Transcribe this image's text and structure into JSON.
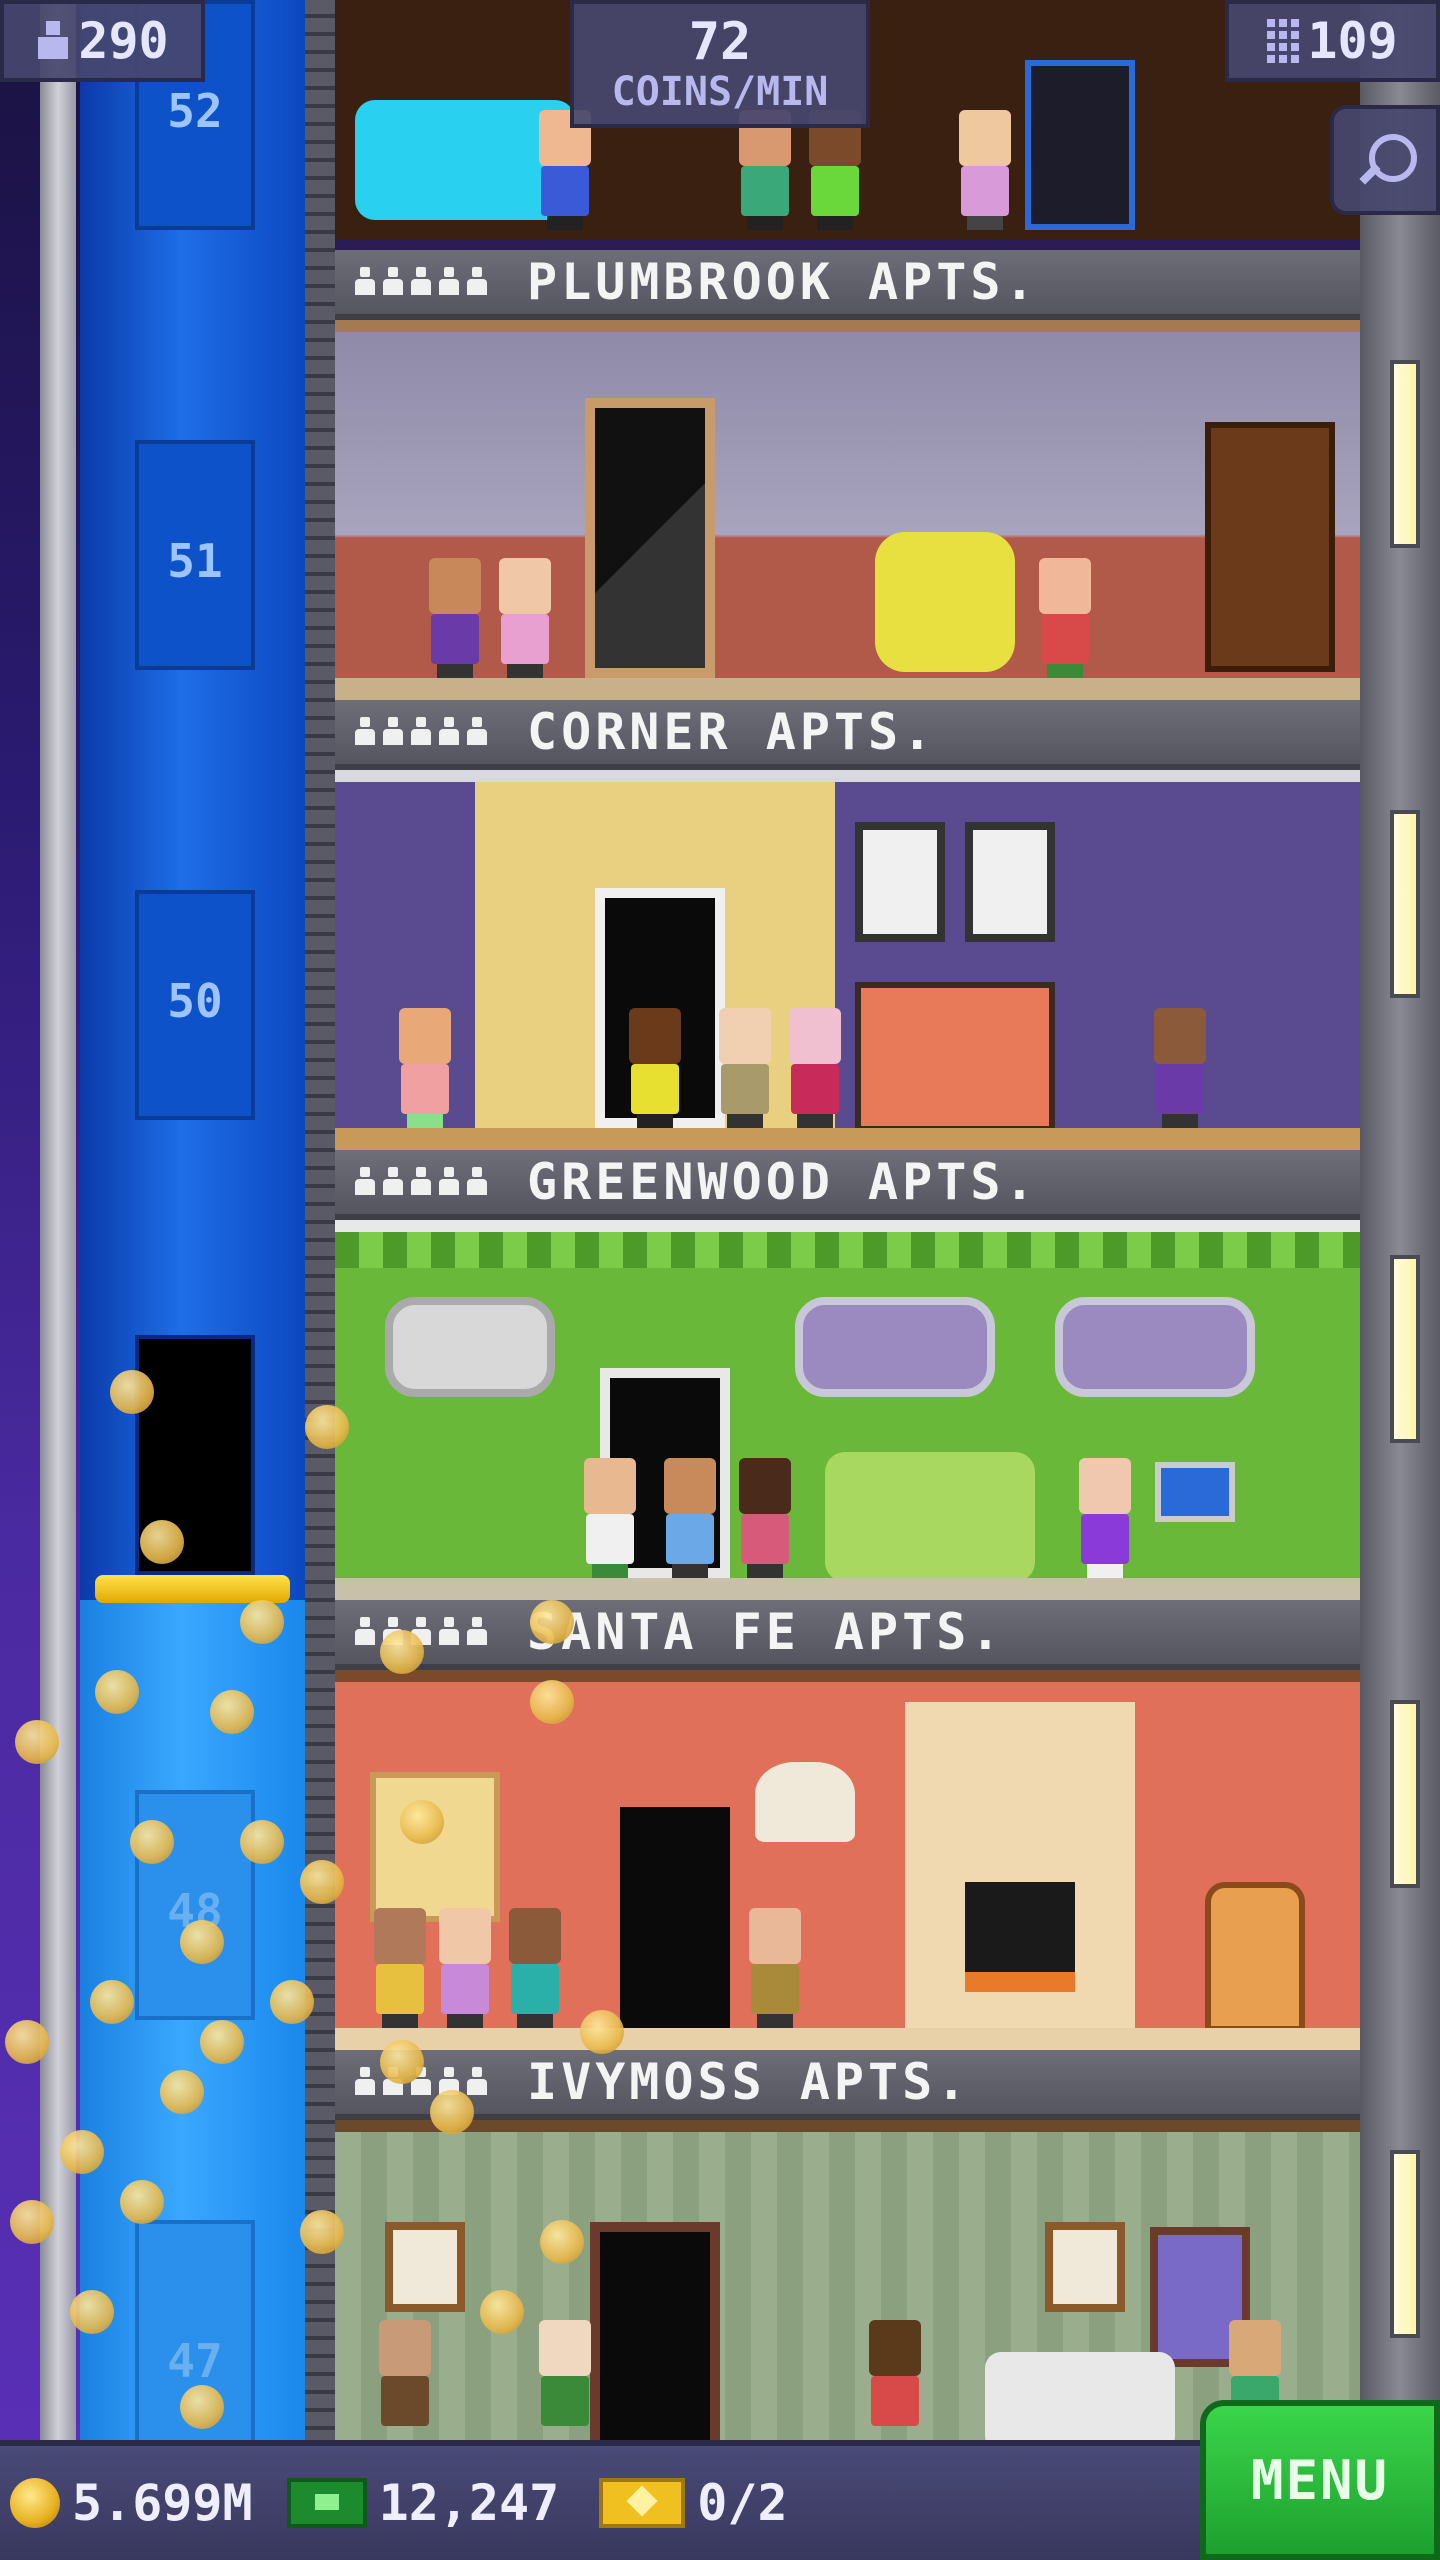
{
  "hud": {
    "population": "290",
    "coins_rate": "72",
    "coins_rate_unit": "COINS/MIN",
    "floor_count": "109"
  },
  "elevator": {
    "floor_numbers": [
      "52",
      "51",
      "50",
      "48",
      "47"
    ]
  },
  "floors": [
    {
      "name": "PLUMBROOK APTS."
    },
    {
      "name": "CORNER APTS."
    },
    {
      "name": "GREENWOOD APTS."
    },
    {
      "name": "SANTA FE APTS."
    },
    {
      "name": "IVYMOSS APTS."
    }
  ],
  "bottom_bar": {
    "coins": "5.699M",
    "bux": "12,247",
    "tickets": "0/2",
    "menu_label": "MENU"
  }
}
